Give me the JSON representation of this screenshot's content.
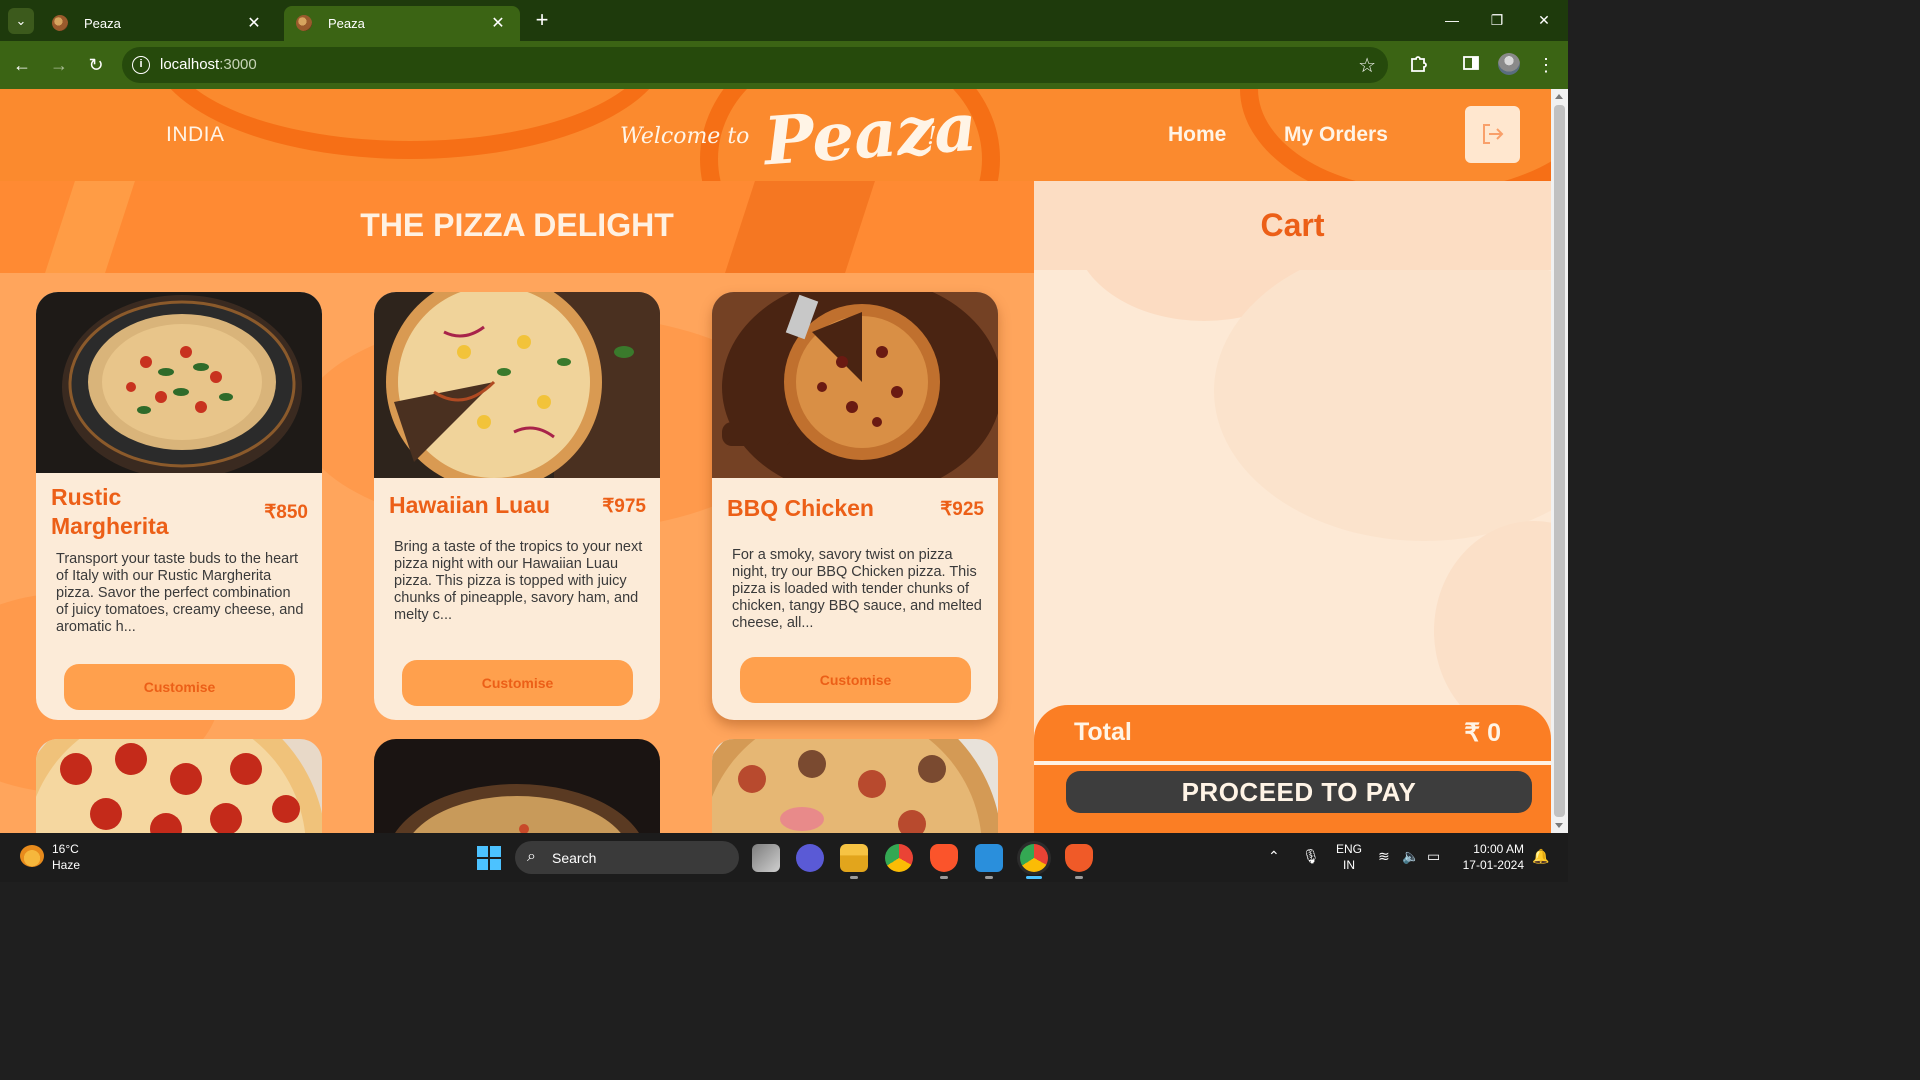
{
  "browser": {
    "tabs": [
      {
        "title": "Peaza",
        "active": false
      },
      {
        "title": "Peaza",
        "active": true
      }
    ],
    "url_host": "localhost",
    "url_port": ":3000"
  },
  "header": {
    "country": "INDIA",
    "welcome": "Welcome to",
    "brand": "Peaza",
    "brand_suffix": "!",
    "nav": [
      {
        "label": "Home"
      },
      {
        "label": "My Orders"
      }
    ]
  },
  "menu": {
    "title": "THE PIZZA DELIGHT",
    "customise_label": "Customise",
    "items": [
      {
        "name": "Rustic Margherita",
        "price": "₹850",
        "description": "Transport your taste buds to the heart of Italy with our Rustic Margherita pizza. Savor the perfect combination of juicy tomatoes, creamy cheese, and aromatic h..."
      },
      {
        "name": "Hawaiian Luau",
        "price": "₹975",
        "description": "Bring a taste of the tropics to your next pizza night with our Hawaiian Luau pizza. This pizza is topped with juicy chunks of pineapple, savory ham, and melty c..."
      },
      {
        "name": "BBQ Chicken",
        "price": "₹925",
        "description": "For a smoky, savory twist on pizza night, try our BBQ Chicken pizza. This pizza is loaded with tender chunks of chicken, tangy BBQ sauce, and melted cheese, all..."
      }
    ]
  },
  "cart": {
    "title": "Cart",
    "total_label": "Total",
    "total_value": "₹ 0",
    "pay_label": "PROCEED TO PAY"
  },
  "taskbar": {
    "temperature": "16°C",
    "weather": "Haze",
    "search_label": "Search",
    "lang_top": "ENG",
    "lang_bottom": "IN",
    "time": "10:00 AM",
    "date": "17-01-2024"
  },
  "colors": {
    "accent": "#ec5f17",
    "header_bg": "#fb8a2e",
    "card_bg": "#fcebd8",
    "button_bg": "#ffa04d",
    "pay_button_bg": "#3d3d3d"
  }
}
